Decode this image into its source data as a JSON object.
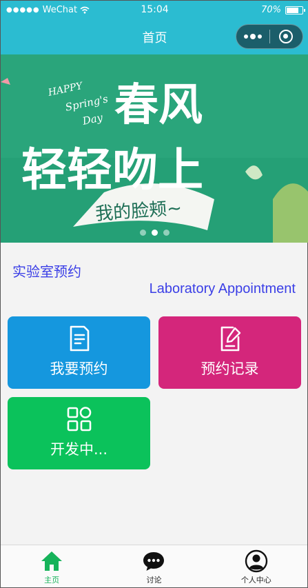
{
  "status_bar": {
    "carrier": "WeChat",
    "time": "15:04",
    "battery": "70%"
  },
  "nav": {
    "title": "首页"
  },
  "banner": {
    "text_en_line1": "HAPPY",
    "text_en_line2": "Spring's",
    "text_en_line3": "Day",
    "text_cn_1": "春风",
    "text_cn_2": "轻轻吻上",
    "text_cn_3": "我的脸颊~",
    "slides": 3,
    "active_slide": 1
  },
  "section": {
    "title": "实验室预约",
    "subtitle": "Laboratory Appointment"
  },
  "tiles": [
    {
      "label": "我要预约",
      "icon": "document-icon",
      "color": "#1597de"
    },
    {
      "label": "预约记录",
      "icon": "edit-note-icon",
      "color": "#d4267b"
    },
    {
      "label": "开发中...",
      "icon": "grid-icon",
      "color": "#0bc25b"
    }
  ],
  "tabbar": {
    "items": [
      {
        "label": "主页",
        "icon": "home-icon",
        "active": true
      },
      {
        "label": "讨论",
        "icon": "chat-icon",
        "active": false
      },
      {
        "label": "个人中心",
        "icon": "user-icon",
        "active": false
      }
    ],
    "active_color": "#16b35a"
  }
}
